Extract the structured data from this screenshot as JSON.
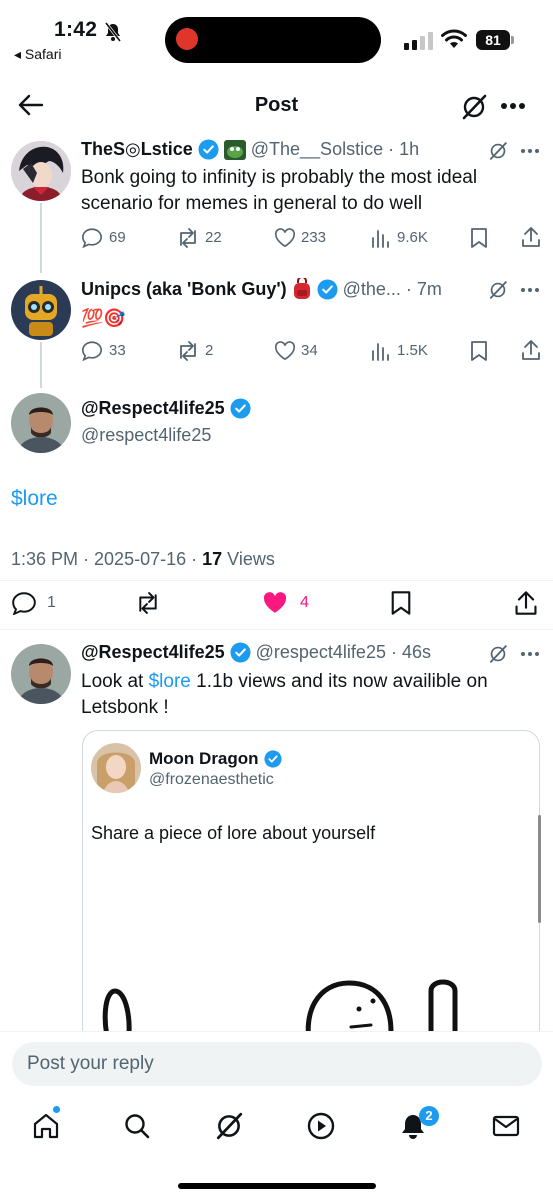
{
  "status_bar": {
    "time": "1:42",
    "back_app": "◂ Safari",
    "battery": "81"
  },
  "header": {
    "title": "Post"
  },
  "thread": [
    {
      "name": "TheS◎Lstice",
      "handle": "@The__Solstice",
      "time": "· 1h",
      "text": "Bonk going to infinity is probably the most ideal scenario for memes in general to do well",
      "replies": "69",
      "reposts": "22",
      "likes": "233",
      "views": "9.6K"
    },
    {
      "name": "Unipcs (aka 'Bonk Guy')",
      "handle": "@the...",
      "time": "· 7m",
      "emojis": "💯🎯",
      "replies": "33",
      "reposts": "2",
      "likes": "34",
      "views": "1.5K"
    }
  ],
  "main_post": {
    "name": "@Respect4life25",
    "handle": "@respect4life25",
    "text": "$lore",
    "timestamp": "1:36 PM · 2025-07-16 · ",
    "views_count": "17",
    "views_label": " Views",
    "replies": "1",
    "likes": "4"
  },
  "reply": {
    "name": "@Respect4life25",
    "handle": "@respect4life25",
    "time": "· 46s",
    "text_before": "Look at ",
    "text_link": "$lore",
    "text_after": "  1.1b views and its now availible on Letsbonk !",
    "quote": {
      "name": "Moon Dragon",
      "handle": "@frozenaesthetic",
      "text": "Share a piece of lore about yourself"
    }
  },
  "compose": {
    "placeholder": "Post your reply"
  },
  "tab_bar": {
    "notification_count": "2"
  },
  "colors": {
    "accent": "#1d9bf0",
    "like_active": "#f91880",
    "secondary_text": "#536471"
  }
}
